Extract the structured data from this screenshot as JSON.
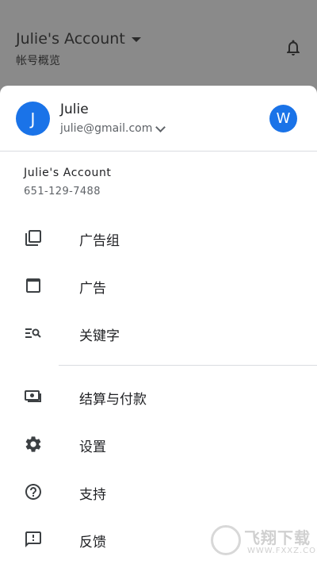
{
  "app_bar": {
    "account_title": "Julie's Account",
    "account_subtitle": "帐号概览",
    "bell_icon": "bell-icon"
  },
  "user": {
    "avatar_letter": "J",
    "name": "Julie",
    "email": "julie@gmail.com",
    "secondary_avatar_letter": "W"
  },
  "account": {
    "name": "Julie's Account",
    "id": "651-129-7488"
  },
  "nav": {
    "items": [
      {
        "label": "广告组",
        "icon": "ad-groups-icon"
      },
      {
        "label": "广告",
        "icon": "ads-icon"
      },
      {
        "label": "关键字",
        "icon": "keywords-icon"
      },
      {
        "label": "结算与付款",
        "icon": "billing-icon"
      },
      {
        "label": "设置",
        "icon": "settings-icon"
      },
      {
        "label": "支持",
        "icon": "help-icon"
      },
      {
        "label": "反馈",
        "icon": "feedback-icon"
      }
    ]
  },
  "watermark": {
    "text": "飞翔下载",
    "subtext": "WWW.FXXZ.COM"
  },
  "colors": {
    "accent": "#1a73e8",
    "scrim": "#8a8a8a",
    "text_primary": "#202124",
    "text_secondary": "#5f6368"
  }
}
